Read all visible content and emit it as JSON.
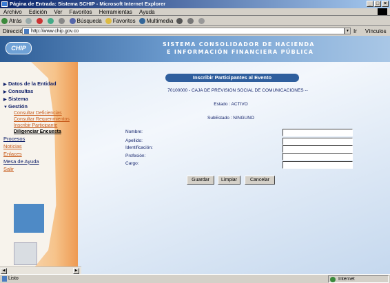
{
  "window": {
    "title": "Página de Entrada: Sistema SCHIP - Microsoft Internet Explorer"
  },
  "menu": [
    "Archivo",
    "Edición",
    "Ver",
    "Favoritos",
    "Herramientas",
    "Ayuda"
  ],
  "toolbar": {
    "back": "Atrás",
    "search": "Búsqueda",
    "favorites": "Favoritos",
    "multimedia": "Multimedia"
  },
  "address": {
    "label": "Dirección",
    "url": "http://www.chip.gov.co",
    "go": "Ir",
    "links": "Vínculos"
  },
  "site": {
    "logo": "CHIP",
    "title_line1": "SISTEMA CONSOLIDADOR DE HACIENDA",
    "title_line2": "E INFORMACIÓN FINANCIERA PÚBLICA"
  },
  "nav": {
    "datos": "Datos de la Entidad",
    "consultas": "Consultas",
    "sistema": "Sistema",
    "gestion": "Gestión",
    "gestion_items": [
      "Consultar Deficiencias",
      "Consultar Requerimientos",
      "Inscribir Participante",
      "Diligenciar Encuesta"
    ],
    "procesos": "Procesos",
    "noticias": "Noticias",
    "enlaces": "Enlaces",
    "mesa": "Mesa de Ayuda",
    "salir": "Salir"
  },
  "form": {
    "heading": "Inscribir Participantes al Evento",
    "entity": "70100000 - CAJA DE PREVISION SOCIAL DE COMUNICACIONES --",
    "estado": "Estado : ACTIVO",
    "subestado": "SubEstado : NINGUNO",
    "fields": {
      "nombre": {
        "label": "Nombre:",
        "value": ""
      },
      "apellido": {
        "label": "Apellido:",
        "value": ""
      },
      "identificacion": {
        "label": "Identificación:",
        "value": ""
      },
      "profesion": {
        "label": "Profesión:",
        "value": ""
      },
      "cargo": {
        "label": "Cargo:",
        "value": ""
      }
    },
    "buttons": {
      "guardar": "Guardar",
      "limpiar": "Limpiar",
      "cancelar": "Cancelar"
    }
  },
  "status": {
    "text": "Listo",
    "zone": "Internet"
  },
  "colors": {
    "nav_dark": "#12226a",
    "nav_link": "#c75a1a",
    "pill": "#2f5f9e"
  }
}
